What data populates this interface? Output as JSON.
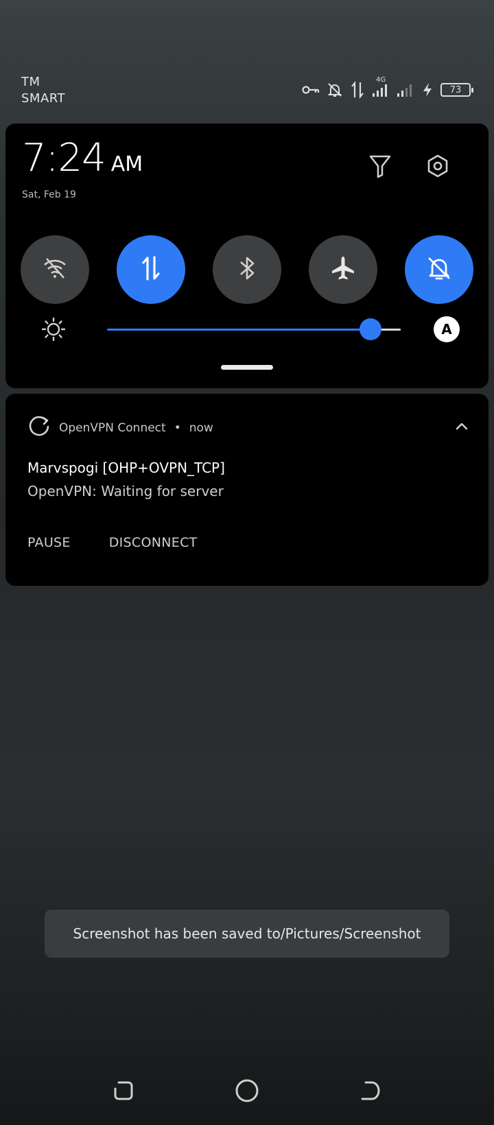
{
  "status_bar": {
    "carrier_line1": "TM",
    "carrier_line2": "SMART",
    "network_type": "4G",
    "battery_level": "73",
    "icons": [
      "vpn-key-icon",
      "notifications-off-icon",
      "data-transfer-icon",
      "signal-icon",
      "signal-icon",
      "charging-icon",
      "battery-icon"
    ]
  },
  "quick_settings": {
    "time": "7:24",
    "ampm": "AM",
    "date": "Sat, Feb 19",
    "tiles": [
      {
        "name": "wifi-off",
        "active": false
      },
      {
        "name": "mobile-data",
        "active": true
      },
      {
        "name": "bluetooth",
        "active": false
      },
      {
        "name": "airplane-mode",
        "active": false
      },
      {
        "name": "do-not-disturb",
        "active": true
      }
    ],
    "brightness_fraction": 0.87,
    "auto_brightness_label": "A",
    "accent_color": "#2f7bf5"
  },
  "notification": {
    "app_name": "OpenVPN Connect",
    "separator": "•",
    "time": "now",
    "title": "Marvspogi [OHP+OVPN_TCP]",
    "text": "OpenVPN: Waiting for server",
    "actions": [
      "PAUSE",
      "DISCONNECT"
    ]
  },
  "toast": {
    "text": "Screenshot has been saved to/Pictures/Screenshot"
  }
}
